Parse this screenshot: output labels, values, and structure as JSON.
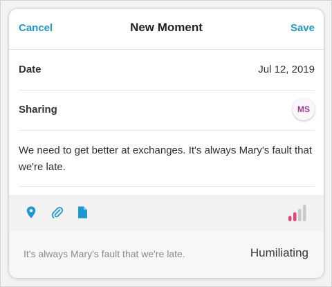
{
  "header": {
    "cancel_label": "Cancel",
    "title": "New Moment",
    "save_label": "Save"
  },
  "date": {
    "label": "Date",
    "value": "Jul 12, 2019"
  },
  "sharing": {
    "label": "Sharing",
    "avatar_initials": "MS"
  },
  "note": {
    "text": "We need to get better at exchanges. It's always Mary's fault that we're late."
  },
  "toolbar": {
    "icons": [
      "location-pin-icon",
      "paperclip-icon",
      "document-icon"
    ],
    "signal_icon": "signal-strength-icon",
    "signal_level": 0.4,
    "accent_color": "#1d98d6",
    "signal_active_color": "#e0467c",
    "signal_inactive_color": "#c8c8c8"
  },
  "footer": {
    "text": "It's always Mary's fault that we're late.",
    "tone_label": "Humiliating"
  }
}
